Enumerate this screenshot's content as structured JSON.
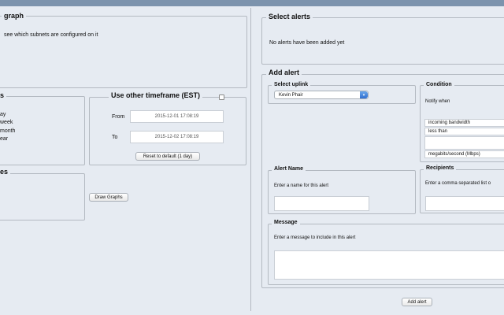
{
  "graph_panel": {
    "legend": "graph",
    "hint": "see which subnets are configured on it"
  },
  "timespan_panel": {
    "legend": "s",
    "options": [
      "ay",
      "week",
      "month",
      "ear"
    ]
  },
  "other_timeframe": {
    "legend": "Use other timeframe (EST)",
    "from_label": "From",
    "from_value": "2015-12-01 17:08:19",
    "to_label": "To",
    "to_value": "2015-12-02 17:08:19",
    "reset_button": "Reset to default (1 day)"
  },
  "third_panel": {
    "legend": "es"
  },
  "draw_graphs_button": "Draw Graphs",
  "select_alerts": {
    "legend": "Select alerts",
    "empty_text": "No alerts have been added yet"
  },
  "add_alert": {
    "legend": "Add alert",
    "uplink": {
      "legend": "Select uplink",
      "selected": "Kevin Phair"
    },
    "condition": {
      "legend": "Condition",
      "notify_label": "Notify when",
      "metric": "incoming bandwidth",
      "comparator": "less than",
      "value": "",
      "unit": "megabits/second (Mbps)"
    },
    "alert_name": {
      "legend": "Alert Name",
      "prompt": "Enter a name for this alert",
      "value": ""
    },
    "recipients": {
      "legend": "Recipients",
      "prompt": "Enter a comma separated list o"
    },
    "message": {
      "legend": "Message",
      "prompt": "Enter a message to include in this alert",
      "value": ""
    },
    "submit_button": "Add alert"
  }
}
